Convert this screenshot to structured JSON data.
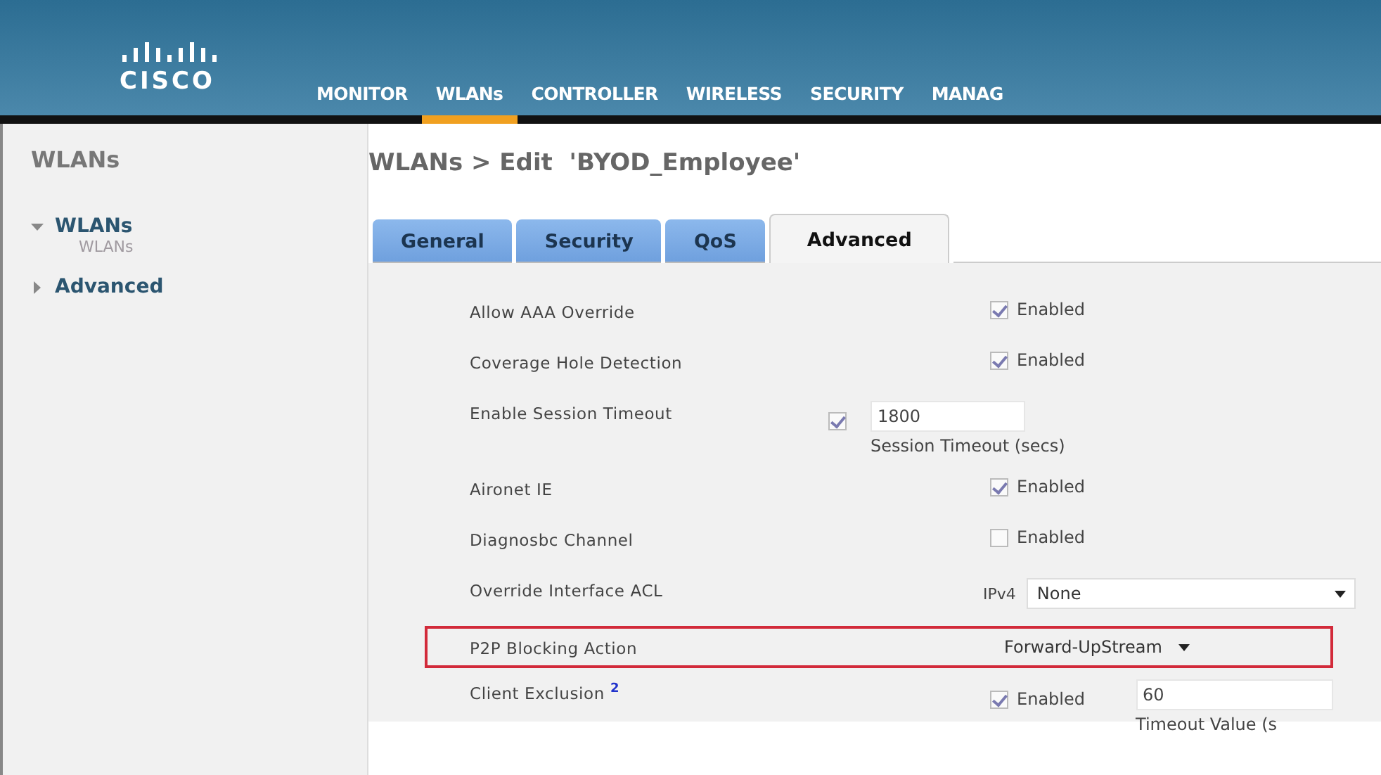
{
  "header": {
    "logo": "CISCO",
    "nav": [
      {
        "label": "MONITOR",
        "selected": false
      },
      {
        "label": "WLANs",
        "selected": true
      },
      {
        "label": "CONTROLLER",
        "selected": false
      },
      {
        "label": "WIRELESS",
        "selected": false
      },
      {
        "label": "SECURITY",
        "selected": false
      },
      {
        "label": "MANAG",
        "selected": false
      }
    ]
  },
  "sidebar": {
    "title": "WLANs",
    "items": [
      {
        "label": "WLANs",
        "expanded": true,
        "children": [
          {
            "label": "WLANs"
          }
        ]
      },
      {
        "label": "Advanced",
        "expanded": false
      }
    ]
  },
  "page_title": "WLANs > Edit  'BYOD_Employee'",
  "tabs": [
    {
      "label": "General",
      "selected": false
    },
    {
      "label": "Security",
      "selected": false
    },
    {
      "label": "QoS",
      "selected": false
    },
    {
      "label": "Advanced",
      "selected": true
    }
  ],
  "rows": [
    {
      "kind": "checkbox",
      "label": "Allow AAA Override",
      "checked": true,
      "option": "Enabled"
    },
    {
      "kind": "checkbox",
      "label": "Coverage Hole Detection",
      "checked": true,
      "option": "Enabled"
    },
    {
      "kind": "timeout",
      "label": "Enable Session Timeout",
      "checked": true,
      "value": "1800",
      "caption": "Session Timeout (secs)"
    },
    {
      "kind": "checkbox",
      "label": "Aironet IE",
      "checked": true,
      "option": "Enabled"
    },
    {
      "kind": "checkbox",
      "label": "Diagnosbc Channel",
      "checked": false,
      "option": "Enabled"
    },
    {
      "kind": "acl",
      "label": "Override Interface ACL",
      "prefix": "IPv4",
      "value": "None"
    },
    {
      "kind": "select",
      "label": "P2P Blocking Action",
      "value": "Forward-UpStream",
      "highlighted": true
    },
    {
      "kind": "exclusion",
      "label": "Client Exclusion",
      "info": "2",
      "checked": true,
      "option": "Enabled",
      "value": "60",
      "caption": "Timeout Value (s"
    }
  ]
}
